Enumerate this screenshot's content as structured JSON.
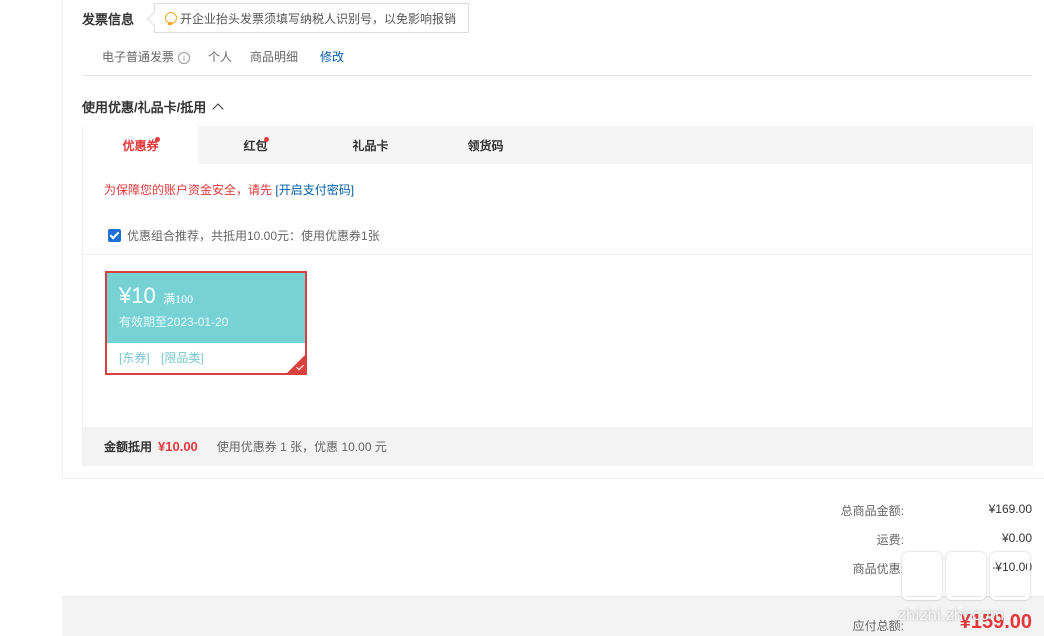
{
  "invoice": {
    "title": "发票信息",
    "tip": "开企业抬头发票须填写纳税人识别号，以免影响报销",
    "type": "电子普通发票",
    "info_icon": "i",
    "holder": "个人",
    "content": "商品明细",
    "modify_label": "修改"
  },
  "coupons": {
    "header": "使用优惠/礼品卡/抵用",
    "tabs": [
      {
        "label": "优惠券"
      },
      {
        "label": "红包"
      },
      {
        "label": "礼品卡"
      },
      {
        "label": "领货码"
      }
    ],
    "security_tip": "为保障您的账户资金安全，请先",
    "security_link": "[开启支付密码]",
    "combo_text": "优惠组合推荐，共抵用10.00元：使用优惠券1张",
    "coupon_card": {
      "amount": "¥10",
      "condition": "满100",
      "expiry": "有效期至2023-01-20",
      "tag_1": "[东券]",
      "tag_2": "[限品类]"
    },
    "summary": {
      "label": "金额抵用",
      "amount": "¥10.00",
      "detail": "使用优惠券 1 张，优惠 10.00 元"
    }
  },
  "totals": {
    "goods_label": "总商品金额:",
    "goods_value": "¥169.00",
    "shipping_label": "运费:",
    "shipping_value": "¥0.00",
    "discount_label": "商品优惠:",
    "discount_value": "-¥10.00"
  },
  "payment": {
    "label": "应付总额:",
    "amount": "¥159.00"
  },
  "watermark": {
    "site": "zhizhi.zhi.com"
  },
  "colors": {
    "accent": "#e4393c",
    "link": "#005ea7",
    "coupon": "#77d2d6"
  }
}
